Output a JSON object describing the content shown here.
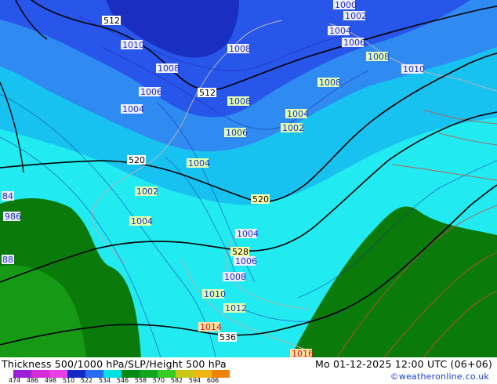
{
  "footer": {
    "title": "Thickness 500/1000 hPa/SLP/Height 500 hPa",
    "datetime": "Mo 01-12-2025 12:00 UTC (06+06)",
    "credit": "©weatheronline.co.uk"
  },
  "legend": {
    "ticks": [
      "474",
      "486",
      "498",
      "510",
      "522",
      "534",
      "546",
      "558",
      "570",
      "582",
      "594",
      "606"
    ],
    "colors": [
      "#9b1fd6",
      "#d42cd6",
      "#e83ee8",
      "#1428c8",
      "#2a6cf0",
      "#00e0e0",
      "#008a14",
      "#12a51e",
      "#3acc26",
      "#c8c814",
      "#f0b414",
      "#f0820a"
    ]
  },
  "map": {
    "colors": {
      "navy": "#1a2ec2",
      "blue": "#2855ea",
      "mid_blue": "#2f8af2",
      "cyan_blue": "#18c2f0",
      "cyan": "#21eaf0",
      "dark_green": "#0a7a0a",
      "green": "#169a16",
      "coast": "#b4b4b4",
      "height_line": "#000000",
      "isobar": "#2222aa",
      "warm_line": "#d24a3a"
    },
    "slp_labels": [
      "1000",
      "1002",
      "1004",
      "1006",
      "1008",
      "1010",
      "1012",
      "1014",
      "1016",
      "986"
    ],
    "height_labels": [
      "512",
      "520",
      "528",
      "536",
      "84",
      "88"
    ]
  }
}
